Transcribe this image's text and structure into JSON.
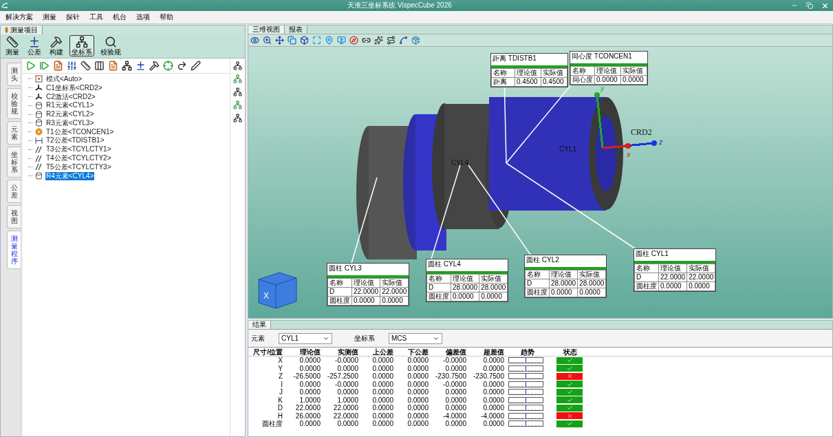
{
  "window": {
    "title": "天准三坐标系统 VispecCube 2026"
  },
  "menu": [
    "解决方案",
    "测量",
    "探针",
    "工具",
    "机台",
    "选项",
    "帮助"
  ],
  "left_panel": {
    "tab": "测量项目",
    "ribbon": [
      {
        "kind": "measure",
        "label": "测量",
        "selected": false
      },
      {
        "kind": "tolerance",
        "label": "公差",
        "selected": false
      },
      {
        "kind": "construct",
        "label": "构建",
        "selected": false
      },
      {
        "kind": "coordinate",
        "label": "坐标系",
        "selected": true
      },
      {
        "kind": "gauge",
        "label": "校验规",
        "selected": false
      }
    ],
    "side_tabs": [
      {
        "label": "测头",
        "selected": false
      },
      {
        "label": "校验规",
        "selected": false
      },
      {
        "label": "元素",
        "selected": false
      },
      {
        "label": "坐标系",
        "selected": false
      },
      {
        "label": "公差",
        "selected": false
      },
      {
        "label": "视图",
        "selected": false
      },
      {
        "label": "测量程序",
        "selected": true
      }
    ],
    "tree": [
      {
        "kind": "mode",
        "label": "模式<Auto>",
        "selected": false
      },
      {
        "kind": "coordinate",
        "label": "C1坐标系<CRD2>",
        "selected": false
      },
      {
        "kind": "coordinate",
        "label": "C2激活<CRD2>",
        "selected": false
      },
      {
        "kind": "cylinder",
        "label": "R1元素<CYL1>",
        "selected": false
      },
      {
        "kind": "cylinder",
        "label": "R2元素<CYL2>",
        "selected": false
      },
      {
        "kind": "cylinder",
        "label": "R3元素<CYL3>",
        "selected": false
      },
      {
        "kind": "concentricity",
        "label": "T1公差<TCONCEN1>",
        "selected": false
      },
      {
        "kind": "distance",
        "label": "T2公差<TDISTB1>",
        "selected": false
      },
      {
        "kind": "cylindricity",
        "label": "T3公差<TCYLCTY1>",
        "selected": false
      },
      {
        "kind": "cylindricity",
        "label": "T4公差<TCYLCTY2>",
        "selected": false
      },
      {
        "kind": "cylindricity",
        "label": "T5公差<TCYLCTY3>",
        "selected": false
      },
      {
        "kind": "cylinder",
        "label": "R4元素<CYL4>",
        "selected": true
      }
    ]
  },
  "view_tabs": [
    {
      "label": "三维视图",
      "selected": true
    },
    {
      "label": "报表",
      "selected": false
    }
  ],
  "viewport": {
    "callouts": [
      {
        "title": "距离 TDISTB1",
        "columns": [
          "名称",
          "理论值",
          "实际值"
        ],
        "rows": [
          [
            "距离",
            "0.4500",
            "0.4500"
          ]
        ]
      },
      {
        "title": "同心度 TCONCEN1",
        "columns": [
          "名称",
          "理论值",
          "实际值"
        ],
        "rows": [
          [
            "同心度",
            "0.0000",
            "0.0000"
          ]
        ]
      },
      {
        "title": "圆柱 CYL3",
        "columns": [
          "名称",
          "理论值",
          "实际值"
        ],
        "rows": [
          [
            "D",
            "22.0000",
            "22.0000"
          ],
          [
            "圆柱度",
            "0.0000",
            "0.0000"
          ]
        ]
      },
      {
        "title": "圆柱 CYL4",
        "columns": [
          "名称",
          "理论值",
          "实际值"
        ],
        "rows": [
          [
            "D",
            "28.0000",
            "28.0000"
          ],
          [
            "圆柱度",
            "0.0000",
            "0.0000"
          ]
        ]
      },
      {
        "title": "圆柱 CYL2",
        "columns": [
          "名称",
          "理论值",
          "实际值"
        ],
        "rows": [
          [
            "D",
            "28.0000",
            "28.0000"
          ],
          [
            "圆柱度",
            "0.0000",
            "0.0000"
          ]
        ]
      },
      {
        "title": "圆柱 CYL1",
        "columns": [
          "名称",
          "理论值",
          "实际值"
        ],
        "rows": [
          [
            "D",
            "22.0000",
            "22.0000"
          ],
          [
            "圆柱度",
            "0.0000",
            "0.0000"
          ]
        ]
      }
    ],
    "part_labels": [
      "CYL4",
      "CYL1"
    ],
    "triad": {
      "label": "CRD2",
      "axes": [
        {
          "label": "y",
          "color": "#1faa2a"
        },
        {
          "label": "z",
          "color": "#1636d8"
        },
        {
          "label": "x",
          "color": "#e01b1b"
        }
      ]
    },
    "view_cube": {
      "face": "X"
    }
  },
  "results": {
    "tab": "结果",
    "element_label": "元素",
    "element_value": "CYL1",
    "cs_label": "坐标系",
    "cs_value": "MCS",
    "columns": [
      "尺寸/位置",
      "理论值",
      "实测值",
      "上公差",
      "下公差",
      "偏差值",
      "超差值",
      "趋势",
      "状态"
    ],
    "rows": [
      {
        "name": "X",
        "values": [
          "0.0000",
          "-0.0000",
          "0.0000",
          "0.0000",
          "-0.0000",
          "0.0000"
        ],
        "pass": true
      },
      {
        "name": "Y",
        "values": [
          "0.0000",
          "0.0000",
          "0.0000",
          "0.0000",
          "0.0000",
          "0.0000"
        ],
        "pass": true
      },
      {
        "name": "Z",
        "values": [
          "-26.5000",
          "-257.2500",
          "0.0000",
          "0.0000",
          "-230.7500",
          "-230.7500"
        ],
        "pass": false
      },
      {
        "name": "I",
        "values": [
          "0.0000",
          "-0.0000",
          "0.0000",
          "0.0000",
          "-0.0000",
          "0.0000"
        ],
        "pass": true
      },
      {
        "name": "J",
        "values": [
          "0.0000",
          "0.0000",
          "0.0000",
          "0.0000",
          "0.0000",
          "0.0000"
        ],
        "pass": true
      },
      {
        "name": "K",
        "values": [
          "1.0000",
          "1.0000",
          "0.0000",
          "0.0000",
          "0.0000",
          "0.0000"
        ],
        "pass": true
      },
      {
        "name": "D",
        "values": [
          "22.0000",
          "22.0000",
          "0.0000",
          "0.0000",
          "0.0000",
          "0.0000"
        ],
        "pass": true
      },
      {
        "name": "H",
        "values": [
          "26.0000",
          "22.0000",
          "0.0000",
          "0.0000",
          "-4.0000",
          "-4.0000"
        ],
        "pass": false
      },
      {
        "name": "圆柱度",
        "values": [
          "0.0000",
          "0.0000",
          "0.0000",
          "0.0000",
          "0.0000",
          "0.0000"
        ],
        "pass": true
      }
    ]
  }
}
